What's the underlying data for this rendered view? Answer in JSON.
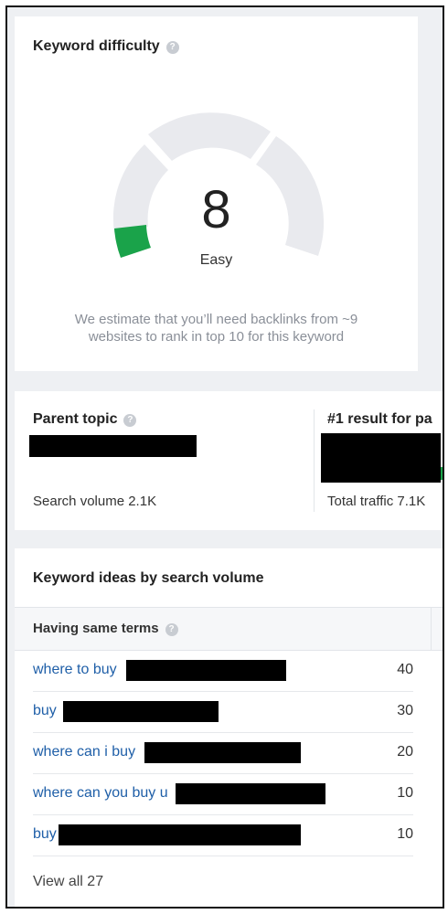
{
  "keyword_difficulty": {
    "title": "Keyword difficulty",
    "info_icon": "question-circle-icon",
    "score": "8",
    "score_fraction": 0.08,
    "label": "Easy",
    "description": "We estimate that you’ll need backlinks from ~9 websites to rank in top 10 for this keyword",
    "colors": {
      "track": "#e9eaee",
      "fill": "#1aa34a"
    }
  },
  "parent_topic": {
    "title": "Parent topic",
    "info_icon": "question-circle-icon",
    "search_volume": "Search volume 2.1K",
    "result_title": "#1 result for pa",
    "total_traffic": "Total traffic 7.1K"
  },
  "keyword_ideas": {
    "title": "Keyword ideas by search volume",
    "tab_label": "Having same terms",
    "info_icon": "question-circle-icon",
    "rows": [
      {
        "keyword": "where to buy",
        "volume": "40"
      },
      {
        "keyword": "buy",
        "volume": "30"
      },
      {
        "keyword": "where can i buy",
        "volume": "20"
      },
      {
        "keyword": "where can you buy u",
        "volume": "10"
      },
      {
        "keyword": "buy",
        "volume": "10"
      }
    ],
    "view_all": "View all 27",
    "colors": {
      "link": "#1f5fa8"
    }
  }
}
